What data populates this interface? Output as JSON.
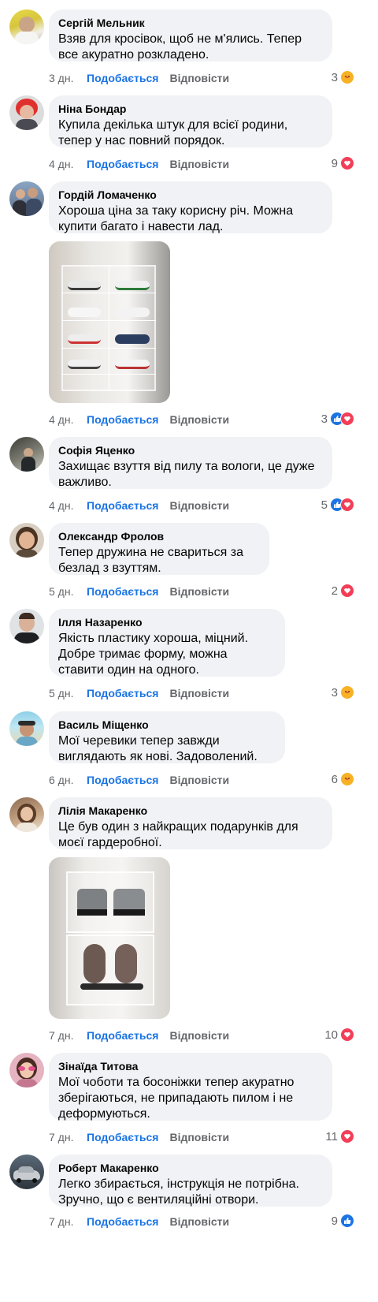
{
  "labels": {
    "like": "Подобається",
    "reply": "Відповісти"
  },
  "colors": {
    "like_blue": "#1b74e4",
    "love_red": "#f33e58",
    "care_yellow": "#f7b125",
    "bubble_bg": "#f0f2f5",
    "meta_gray": "#65676b"
  },
  "comments": [
    {
      "author": "Сергій Мельник",
      "text": "Взяв для кросівок, щоб не м'ялись. Тепер все акуратно розкладено.",
      "time": "3 дн.",
      "count": "3",
      "reactions": [
        "care"
      ]
    },
    {
      "author": "Ніна Бондар",
      "text": "Купила декілька штук для всієї родини, тепер у нас повний порядок.",
      "time": "4 дн.",
      "count": "9",
      "reactions": [
        "love"
      ]
    },
    {
      "author": "Гордій Ломаченко",
      "text": "Хороша ціна за таку корисну річ. Можна купити багато і навести лад.",
      "time": "4 дн.",
      "count": "3",
      "reactions": [
        "like",
        "love"
      ]
    },
    {
      "author": "Софія Яценко",
      "text": "Захищає взуття від пилу та вологи, це дуже важливо.",
      "time": "4 дн.",
      "count": "5",
      "reactions": [
        "like",
        "love"
      ]
    },
    {
      "author": "Олександр Фролов",
      "text": "Тепер дружина не свариться за безлад з взуттям.",
      "time": "5 дн.",
      "count": "2",
      "reactions": [
        "love"
      ]
    },
    {
      "author": "Ілля Назаренко",
      "text": "Якість пластику хороша, міцний. Добре тримає форму, можна ставити один на одного.",
      "time": "5 дн.",
      "count": "3",
      "reactions": [
        "care"
      ]
    },
    {
      "author": "Василь Міщенко",
      "text": "Мої черевики тепер завжди виглядають як нові. Задоволений.",
      "time": "6 дн.",
      "count": "6",
      "reactions": [
        "care"
      ]
    },
    {
      "author": "Лілія Макаренко",
      "text": "Це був один з найкращих подарунків для моєї гардеробної.",
      "time": "7 дн.",
      "count": "10",
      "reactions": [
        "love"
      ]
    },
    {
      "author": "Зінаїда Титова",
      "text": "Мої чоботи та босоніжки тепер акуратно зберігаються, не припадають пилом і не деформуються.",
      "time": "7 дн.",
      "count": "11",
      "reactions": [
        "love"
      ]
    },
    {
      "author": "Роберт Макаренко",
      "text": "Легко збирається, інструкція не потрібна. Зручно, що є вентиляційні отвори.",
      "time": "7 дн.",
      "count": "9",
      "reactions": [
        "like"
      ]
    }
  ]
}
